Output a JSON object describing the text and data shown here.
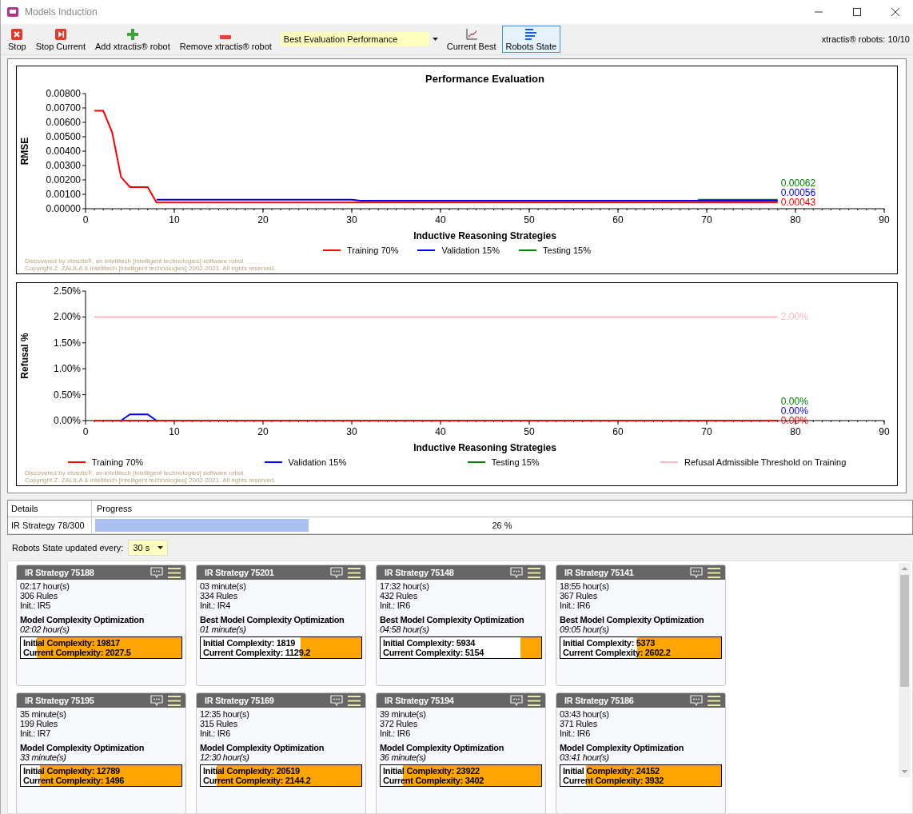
{
  "window": {
    "title": "Models Induction"
  },
  "toolbar": {
    "items": [
      {
        "kind": "stop",
        "label": "Stop",
        "selected": false
      },
      {
        "kind": "stop-current",
        "label": "Stop Current",
        "selected": false
      },
      {
        "kind": "add",
        "label": "Add xtractis® robot",
        "selected": false
      },
      {
        "kind": "remove",
        "label": "Remove xtractis® robot",
        "selected": false
      },
      {
        "kind": "dropdown",
        "value": "Best Evaluation Performance"
      },
      {
        "kind": "chart",
        "label": "Current Best",
        "selected": false
      },
      {
        "kind": "list",
        "label": "Robots State",
        "selected": true
      }
    ],
    "robots_count": "xtractis® robots: 10/10"
  },
  "charts": [
    {
      "chart_data": {
        "type": "line",
        "title": "Performance Evaluation",
        "xlabel": "Inductive Reasoning Strategies",
        "ylabel": "RMSE",
        "x": [
          1,
          2,
          3,
          4,
          5,
          6,
          7,
          8,
          30,
          31,
          68,
          69,
          78
        ],
        "xlim": [
          0,
          90
        ],
        "ylim": [
          0,
          0.008
        ],
        "xticks": [
          0,
          10,
          20,
          30,
          40,
          50,
          60,
          70,
          80,
          90
        ],
        "legend": true,
        "yticks": [
          {
            "value": 0,
            "label": "0.00000"
          },
          {
            "value": 0.001,
            "label": "0.00100"
          },
          {
            "value": 0.002,
            "label": "0.00200"
          },
          {
            "value": 0.003,
            "label": "0.00300"
          },
          {
            "value": 0.004,
            "label": "0.00400"
          },
          {
            "value": 0.005,
            "label": "0.00500"
          },
          {
            "value": 0.006,
            "label": "0.00600"
          },
          {
            "value": 0.007,
            "label": "0.00700"
          },
          {
            "value": 0.008,
            "label": "0.00800"
          }
        ],
        "series": [
          {
            "name": "Training 70%",
            "color": "#ff0000",
            "values": [
              0.0068,
              0.0068,
              0.0053,
              0.0022,
              0.0015,
              0.0015,
              0.0015,
              0.00043,
              0.00043,
              0.00043,
              0.00043,
              0.00043,
              0.00043
            ]
          },
          {
            "name": "Validation 15%",
            "color": "#0000ff",
            "values": [
              null,
              null,
              null,
              null,
              null,
              null,
              null,
              0.00062,
              0.00062,
              0.00056,
              0.00056,
              0.00056,
              0.00056
            ]
          },
          {
            "name": "Testing 15%",
            "color": "#008000",
            "values": [
              null,
              null,
              null,
              null,
              null,
              null,
              null,
              null,
              null,
              null,
              null,
              0.00062,
              0.00062
            ]
          }
        ],
        "annotations": [
          "0.00062",
          "0.00056",
          "0.00043"
        ]
      },
      "notes": [
        "Discovered by xtractis®, an intellitech [intelligent technologies] software robot",
        "Copyright Z. ZALILA & intellitech [intelligent technologies] 2002-2021. All rights reserved."
      ]
    },
    {
      "chart_data": {
        "type": "line",
        "xlabel": "Inductive Reasoning Strategies",
        "ylabel": "Refusal %",
        "x": [
          1,
          4,
          5,
          7,
          8,
          78
        ],
        "xlim": [
          0,
          90
        ],
        "ylim": [
          0,
          2.5
        ],
        "xticks": [
          0,
          10,
          20,
          30,
          40,
          50,
          60,
          70,
          80,
          90
        ],
        "legend": true,
        "yticks": [
          {
            "value": 0,
            "label": "0.00%"
          },
          {
            "value": 0.5,
            "label": "0.50%"
          },
          {
            "value": 1,
            "label": "1.00%"
          },
          {
            "value": 1.5,
            "label": "1.50%"
          },
          {
            "value": 2,
            "label": "2.00%"
          },
          {
            "value": 2.5,
            "label": "2.50%"
          }
        ],
        "series": [
          {
            "name": "Training 70%",
            "color": "#ff0000",
            "values": [
              0,
              0,
              0,
              0,
              0,
              0
            ]
          },
          {
            "name": "Validation 15%",
            "color": "#0000ff",
            "values": [
              null,
              0,
              0.12,
              0.12,
              0,
              null
            ]
          },
          {
            "name": "Testing 15%",
            "color": "#008000",
            "values": [
              null,
              null,
              null,
              null,
              null,
              null
            ]
          },
          {
            "name": "Refusal Admissible Threshold on Training",
            "color": "#ffb6c1",
            "values": [
              2,
              2,
              2,
              2,
              2,
              2
            ]
          }
        ],
        "annotations": [
          "2.00%",
          "0.00%",
          "0.00%",
          "0.00%"
        ]
      },
      "notes": [
        "Discovered by xtractis®, an intellitech [intelligent technologies] software robot",
        "Copyright Z. ZALILA & intellitech [intelligent technologies] 2002-2021. All rights reserved."
      ]
    }
  ],
  "progress_table": {
    "columns": [
      "Details",
      "Progress"
    ],
    "rows": [
      {
        "details": "IR Strategy 78/300",
        "level": 0.26,
        "reading": "26 %"
      }
    ]
  },
  "refresh": {
    "label": "Robots State updated every:",
    "value": "30 s"
  },
  "robots": [
    {
      "title": "IR Strategy 75188",
      "elapsed": "02:17 hour(s)",
      "rules": "306 Rules",
      "init": "Init.: IR5",
      "phase": "Model Complexity Optimization",
      "phase_time": "02:02 hour(s)",
      "initial": "Initial Complexity: 19817",
      "current": "Current Complexity: 2027.5",
      "level": 0.9
    },
    {
      "title": "IR Strategy 75201",
      "elapsed": "03 minute(s)",
      "rules": "334 Rules",
      "init": "Init.: IR4",
      "phase": "Best Model Complexity Optimization",
      "phase_time": "01 minute(s)",
      "initial": "Initial Complexity: 1819",
      "current": "Current Complexity: 1129.2",
      "level": 0.38
    },
    {
      "title": "IR Strategy 75148",
      "elapsed": "17:32 hour(s)",
      "rules": "432 Rules",
      "init": "Init.: IR6",
      "phase": "Best Model Complexity Optimization",
      "phase_time": "04:58 hour(s)",
      "initial": "Initial Complexity: 5934",
      "current": "Current Complexity: 5154",
      "level": 0.13
    },
    {
      "title": "IR Strategy 75141",
      "elapsed": "18:55 hour(s)",
      "rules": "367 Rules",
      "init": "Init.: IR6",
      "phase": "Best Model Complexity Optimization",
      "phase_time": "09:05 hour(s)",
      "initial": "Initial Complexity: 5373",
      "current": "Current Complexity: 2602.2",
      "level": 0.52
    },
    {
      "title": "IR Strategy 75195",
      "elapsed": "35 minute(s)",
      "rules": "199 Rules",
      "init": "Init.: IR7",
      "phase": "Model Complexity Optimization",
      "phase_time": "33 minute(s)",
      "initial": "Initial Complexity: 12789",
      "current": "Current Complexity: 1496",
      "level": 0.88
    },
    {
      "title": "IR Strategy 75169",
      "elapsed": "12:35 hour(s)",
      "rules": "315 Rules",
      "init": "Init.: IR6",
      "phase": "Model Complexity Optimization",
      "phase_time": "12:30 hour(s)",
      "initial": "Initial Complexity: 20519",
      "current": "Current Complexity: 2144.2",
      "level": 0.9
    },
    {
      "title": "IR Strategy 75194",
      "elapsed": "39 minute(s)",
      "rules": "372 Rules",
      "init": "Init.: IR6",
      "phase": "Model Complexity Optimization",
      "phase_time": "36 minute(s)",
      "initial": "Initial Complexity: 23922",
      "current": "Current Complexity: 3402",
      "level": 0.86
    },
    {
      "title": "IR Strategy 75186",
      "elapsed": "03:43 hour(s)",
      "rules": "371 Rules",
      "init": "Init.: IR6",
      "phase": "Model Complexity Optimization",
      "phase_time": "03:41 hour(s)",
      "initial": "Initial Complexity: 24152",
      "current": "Current Complexity: 3932",
      "level": 0.84
    }
  ]
}
